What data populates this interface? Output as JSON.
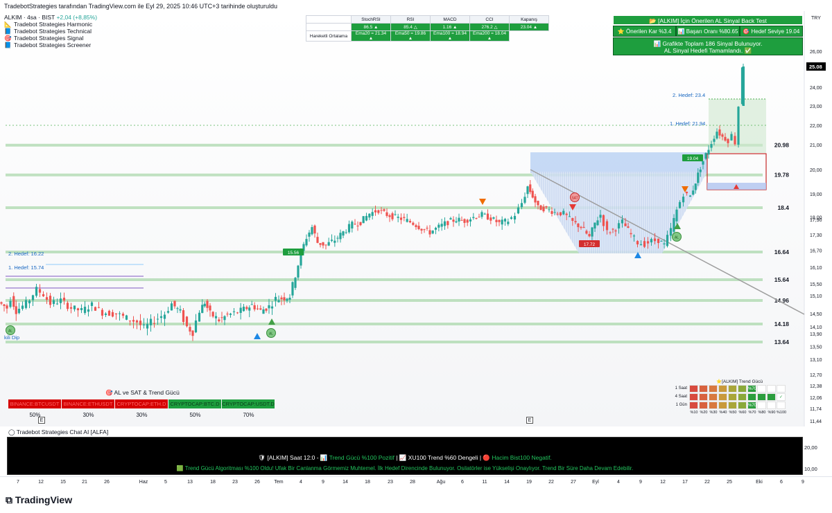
{
  "header": {
    "text": "TradebotStrategies tarafından TradingView.com ile Eyl 29, 2025 10:46 UTC+3 tarihinde oluşturuldu"
  },
  "legend": {
    "symbol": "ALKIM · 4sa · BIST",
    "change": "+2,04 (+8,85%)",
    "items": [
      {
        "icon": "harmonic-icon",
        "label": "Tradebot Strategies Harmonic"
      },
      {
        "icon": "technical-icon",
        "label": "Tradebot Strategies Technical"
      },
      {
        "icon": "signal-icon",
        "label": "Tradebot Strategies Signal"
      },
      {
        "icon": "screener-icon",
        "label": "Tradebot Strategies Screener"
      }
    ]
  },
  "indicators": {
    "headers": [
      "StochRSI",
      "RSI",
      "MACD",
      "CCI",
      "Kapanış"
    ],
    "values": [
      "86.5 ▲",
      "85.4 △",
      "1.16 ▲",
      "276.2 △",
      "23.04 ▲"
    ],
    "ma_label": "Hareketli Ortalama",
    "ma_values": [
      "Ema20 = 21.34 ▲",
      "Ema50 = 19.86 ▲",
      "Ema100 = 18.94 ▲",
      "Ema200 = 18.04 ▲"
    ]
  },
  "backtest": {
    "title": "📂 [ALKIM] İçin Önerilen AL Sinyal Back Test",
    "cells": [
      "⭐ Önerilen Kar %3.4",
      "📊 Başarı Oranı %80.65",
      "🎯 Hedef Seviye 19.04"
    ],
    "message_1": "📊 Grafikte Toplam 186 Sinyal Bulunuyor.",
    "message_2": "AL Sinyal Hedefi Tamamlandı. ✅"
  },
  "crypto": {
    "title": "🎯 AL ve SAT & Trend Gücü",
    "cells": [
      {
        "label": "BINANCE:BTCUSDT",
        "state": "red",
        "pct": "50%"
      },
      {
        "label": "BINANCE:ETHUSDT",
        "state": "red",
        "pct": "30%"
      },
      {
        "label": "CRYPTOCAP:ETH.D",
        "state": "red",
        "pct": "30%"
      },
      {
        "label": "CRYPTOCAP:BTC.D",
        "state": "grn",
        "pct": "50%"
      },
      {
        "label": "CRYPTOCAP:USDT.D",
        "state": "grn",
        "pct": "70%"
      }
    ]
  },
  "trend_strength": {
    "title": "⭐[ALKIM] Trend Gücü",
    "rows": [
      {
        "label": "1 Saat",
        "filled": 7,
        "mark": "%70"
      },
      {
        "label": "4 Saat",
        "filled": 10,
        "mark": "✓"
      },
      {
        "label": "1 Gün",
        "filled": 7,
        "mark": "%70"
      }
    ],
    "axis": [
      "%10",
      "%20",
      "%30",
      "%40",
      "%50",
      "%60",
      "%70",
      "%80",
      "%90",
      "%100"
    ],
    "colors": [
      "#d84b3f",
      "#d8623f",
      "#d8793f",
      "#c99a3b",
      "#a9a63a",
      "#8aa93a",
      "#2c9e3e",
      "#2c9e3e",
      "#2c9e3e",
      "#2c9e3e"
    ]
  },
  "chat": {
    "title": "Tradebot Strategies Chat AI [ALFA]",
    "line1_a": "🛡 [ALKIM] Saat 12:0 -",
    "line1_b": "📊 Trend Gücü %100 Pozitif",
    "line1_c": "📈 XU100 Trend %60 Dengeli",
    "line1_d": "🔴 Hacim Bist100 Negatif.",
    "line2": "🟩 Trend Gücü Algoritması %100 Oldu! Ufak Bir Canlanma Görmemiz Muhtemel. İlk Hedef Direncinde Bulunuyor. Osilatörler ise Yükselişi Onaylıyor. Trend Bir Süre Daha Devam Edebilir."
  },
  "price_axis_2": [
    "20,00",
    "10,00"
  ],
  "x_axis": [
    {
      "label": "7",
      "x": 26
    },
    {
      "label": "12",
      "x": 59
    },
    {
      "label": "15",
      "x": 91
    },
    {
      "label": "21",
      "x": 122
    },
    {
      "label": "26",
      "x": 154
    },
    {
      "label": "Haz",
      "x": 207
    },
    {
      "label": "5",
      "x": 239
    },
    {
      "label": "13",
      "x": 274
    },
    {
      "label": "18",
      "x": 307
    },
    {
      "label": "23",
      "x": 339
    },
    {
      "label": "26",
      "x": 371
    },
    {
      "label": "Tem",
      "x": 402
    },
    {
      "label": "4",
      "x": 434
    },
    {
      "label": "9",
      "x": 466
    },
    {
      "label": "14",
      "x": 498
    },
    {
      "label": "18",
      "x": 530
    },
    {
      "label": "23",
      "x": 563
    },
    {
      "label": "28",
      "x": 595
    },
    {
      "label": "Ağu",
      "x": 636
    },
    {
      "label": "6",
      "x": 667
    },
    {
      "label": "11",
      "x": 699
    },
    {
      "label": "14",
      "x": 731
    },
    {
      "label": "19",
      "x": 763
    },
    {
      "label": "22",
      "x": 795
    },
    {
      "label": "27",
      "x": 827
    },
    {
      "label": "Eyl",
      "x": 859
    },
    {
      "label": "4",
      "x": 892
    },
    {
      "label": "9",
      "x": 924
    },
    {
      "label": "12",
      "x": 956
    },
    {
      "label": "17",
      "x": 988
    },
    {
      "label": "22",
      "x": 1020
    },
    {
      "label": "25",
      "x": 1052
    },
    {
      "label": "Eki",
      "x": 1095
    },
    {
      "label": "6",
      "x": 1127
    },
    {
      "label": "9",
      "x": 1158
    }
  ],
  "brand": "TradingView",
  "chart_data": {
    "type": "candlestick",
    "symbol": "ALKIM",
    "timeframe": "4sa",
    "exchange": "BIST",
    "price_axis_label": "TRY",
    "last_price": 25.08,
    "ylim": [
      11.3,
      26.8
    ],
    "y_ticks": [
      "26,00",
      "25,00",
      "24,00",
      "23,00",
      "22,00",
      "21,00",
      "20,00",
      "19,00",
      "18,00",
      "17,90",
      "17,30",
      "16,70",
      "16,10",
      "15,50",
      "15,10",
      "14,50",
      "14,10",
      "13,90",
      "13,50",
      "13,10",
      "12,70",
      "12,38",
      "12,06",
      "11,74",
      "11,44"
    ],
    "horizontal_levels": [
      20.98,
      19.78,
      18.4,
      16.64,
      15.64,
      14.96,
      14.18,
      13.64
    ],
    "target_labels": [
      {
        "text": "2. Hedef: 23.4",
        "price": 23.4
      },
      {
        "text": "1. Hedef: 21.94",
        "price": 21.94
      },
      {
        "text": "2. Hedef: 16.22",
        "price": 16.22
      },
      {
        "text": "1. Hedef: 15.74",
        "price": 15.74
      }
    ],
    "signal_labels": [
      "15.56",
      "19.04",
      "17.72"
    ],
    "al_badge": "AL",
    "sat_badge": "SAT",
    "left_label": "kili Dip",
    "close_path": [
      [
        0,
        14.9
      ],
      [
        12,
        14.7
      ],
      [
        18,
        15.05
      ],
      [
        25,
        14.6
      ],
      [
        40,
        14.85
      ],
      [
        55,
        15.3
      ],
      [
        65,
        15.15
      ],
      [
        75,
        14.85
      ],
      [
        90,
        14.95
      ],
      [
        105,
        14.7
      ],
      [
        120,
        14.6
      ],
      [
        135,
        14.8
      ],
      [
        150,
        14.55
      ],
      [
        170,
        14.5
      ],
      [
        185,
        14.35
      ],
      [
        200,
        14.25
      ],
      [
        210,
        14.05
      ],
      [
        225,
        14.3
      ],
      [
        240,
        14.5
      ],
      [
        250,
        14.85
      ],
      [
        262,
        14.55
      ],
      [
        272,
        14.1
      ],
      [
        280,
        13.95
      ],
      [
        290,
        14.6
      ],
      [
        297,
        14.9
      ],
      [
        305,
        14.5
      ],
      [
        318,
        14.3
      ],
      [
        330,
        14.45
      ],
      [
        345,
        14.55
      ],
      [
        358,
        14.7
      ],
      [
        365,
        14.8
      ],
      [
        378,
        14.6
      ],
      [
        390,
        14.75
      ],
      [
        400,
        15.0
      ],
      [
        412,
        15.05
      ],
      [
        420,
        15.1
      ],
      [
        428,
        15.8
      ],
      [
        436,
        16.6
      ],
      [
        444,
        17.2
      ],
      [
        452,
        17.6
      ],
      [
        460,
        17.0
      ],
      [
        472,
        16.9
      ],
      [
        485,
        17.1
      ],
      [
        497,
        17.4
      ],
      [
        510,
        17.7
      ],
      [
        522,
        17.8
      ],
      [
        535,
        18.15
      ],
      [
        548,
        18.3
      ],
      [
        560,
        18.1
      ],
      [
        572,
        18.0
      ],
      [
        585,
        17.9
      ],
      [
        598,
        17.75
      ],
      [
        610,
        17.55
      ],
      [
        622,
        17.4
      ],
      [
        635,
        17.6
      ],
      [
        648,
        17.8
      ],
      [
        660,
        17.9
      ],
      [
        672,
        17.85
      ],
      [
        685,
        18.0
      ],
      [
        697,
        18.1
      ],
      [
        710,
        17.95
      ],
      [
        722,
        17.75
      ],
      [
        735,
        17.85
      ],
      [
        745,
        18.1
      ],
      [
        755,
        18.6
      ],
      [
        763,
        19.3
      ],
      [
        770,
        18.9
      ],
      [
        778,
        18.4
      ],
      [
        790,
        18.35
      ],
      [
        802,
        18.2
      ],
      [
        815,
        18.15
      ],
      [
        828,
        17.8
      ],
      [
        840,
        17.6
      ],
      [
        852,
        17.2
      ],
      [
        860,
        17.75
      ],
      [
        868,
        18.1
      ],
      [
        878,
        17.4
      ],
      [
        890,
        17.55
      ],
      [
        900,
        17.8
      ],
      [
        912,
        17.3
      ],
      [
        922,
        17.0
      ],
      [
        932,
        16.95
      ],
      [
        942,
        17.05
      ],
      [
        952,
        17.1
      ],
      [
        960,
        16.9
      ],
      [
        970,
        17.5
      ],
      [
        978,
        18.3
      ],
      [
        988,
        19.0
      ],
      [
        998,
        18.9
      ],
      [
        1005,
        19.5
      ],
      [
        1012,
        20.1
      ],
      [
        1020,
        20.6
      ],
      [
        1028,
        21.1
      ],
      [
        1036,
        21.7
      ],
      [
        1044,
        21.4
      ],
      [
        1052,
        21.2
      ],
      [
        1058,
        21.5
      ],
      [
        1062,
        21.1
      ],
      [
        1068,
        23.0
      ],
      [
        1073,
        25.08
      ]
    ],
    "level_colors": {
      "support_resistance": "#a5d6a7",
      "trendline": "#9e9e9e",
      "bull": "#26a69a",
      "bear": "#ef5350"
    }
  }
}
